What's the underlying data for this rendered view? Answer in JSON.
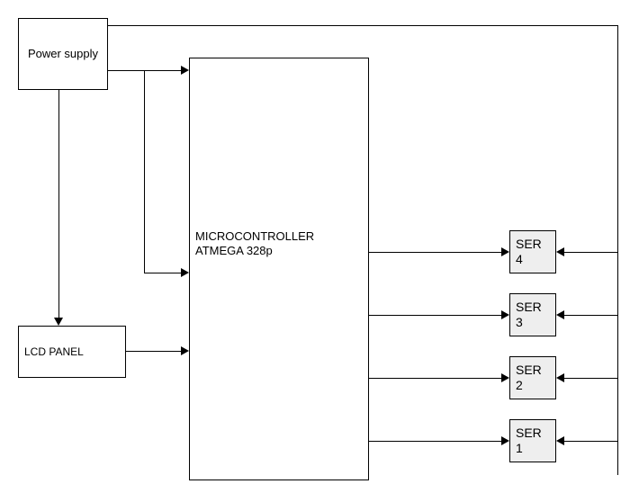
{
  "blocks": {
    "power": "Power supply",
    "lcd": "LCD PANEL",
    "mcu_line1": "MICROCONTROLLER",
    "mcu_line2": "ATMEGA 328p",
    "ser4_line1": "SER",
    "ser4_line2": "4",
    "ser3_line1": "SER",
    "ser3_line2": "3",
    "ser2_line1": "SER",
    "ser2_line2": "2",
    "ser1_line1": "SER",
    "ser1_line2": "1"
  }
}
